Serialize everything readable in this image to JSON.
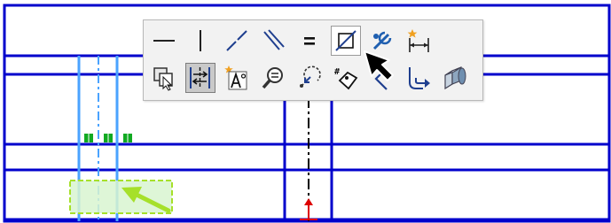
{
  "colors": {
    "sketch_line": "#0000cc",
    "construction_line": "#4aa3ff",
    "centerline": "#000000",
    "relation_marker": "#11aa22",
    "selection_box_fill": "#d8f5d0",
    "selection_box_border": "#a6e02a",
    "pointer_arrow": "#a6e02a",
    "toolbar_bg": "#f2f2f2"
  },
  "toolbar": {
    "row1": [
      {
        "icon": "horizontal-relation-icon"
      },
      {
        "icon": "vertical-relation-icon"
      },
      {
        "icon": "collinear-relation-icon"
      },
      {
        "icon": "parallel-relation-icon"
      },
      {
        "icon": "equal-relation-icon"
      },
      {
        "icon": "perpendicular-relation-icon",
        "state": "hover"
      },
      {
        "icon": "fix-relation-icon"
      },
      {
        "icon": "smart-dimension-icon"
      }
    ],
    "row2": [
      {
        "icon": "copy-entities-icon"
      },
      {
        "icon": "mirror-entities-icon",
        "state": "active"
      },
      {
        "icon": "add-text-icon"
      },
      {
        "icon": "zoom-to-selection-icon"
      },
      {
        "icon": "convert-entities-icon"
      },
      {
        "icon": "add-relation-icon"
      },
      {
        "icon": "tangent-arc-icon"
      },
      {
        "icon": "offset-entities-icon"
      },
      {
        "icon": "extruded-boss-icon"
      }
    ]
  }
}
